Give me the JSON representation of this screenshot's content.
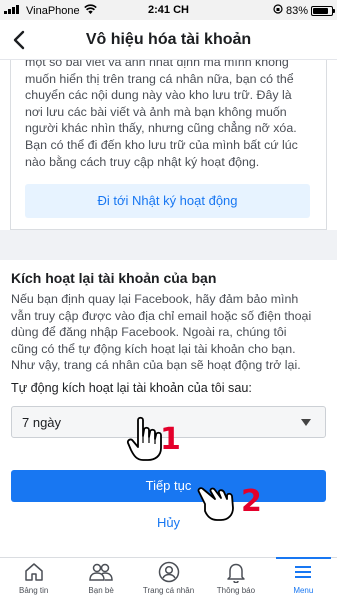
{
  "status_bar": {
    "carrier": "VinaPhone",
    "time": "2:41 CH",
    "battery": "83%",
    "battery_level": 0.83
  },
  "header": {
    "title": "Vô hiệu hóa tài khoản"
  },
  "archive_card": {
    "lines": [
      "một số bài viết và ảnh nhất định mà mình không",
      "muốn hiển thị trên trang cá nhân nữa, bạn có thể",
      "chuyển các nội dung này vào kho lưu trữ. Đây là",
      "nơi lưu các bài viết và ảnh mà bạn không muốn",
      "người khác nhìn thấy, nhưng cũng chẳng nỡ xóa.",
      "Bạn có thể đi đến kho lưu trữ của mình bất cứ lúc",
      "nào bằng cách truy cập nhật ký hoạt động."
    ],
    "button": "Đi tới Nhật ký hoạt động"
  },
  "reactivate": {
    "heading": "Kích hoạt lại tài khoản của bạn",
    "lines": [
      "Nếu bạn định quay lại Facebook, hãy đảm bảo mình",
      "vẫn truy cập được vào địa chỉ email hoặc số điện thoại",
      "dùng để đăng nhập Facebook. Ngoài ra, chúng tôi",
      "cũng có thể tự động kích hoạt lại tài khoản cho bạn.",
      "Như vậy, trang cá nhân của bạn sẽ hoạt động trở lại."
    ],
    "auto_label": "Tự động kích hoạt lại tài khoản của tôi sau:",
    "select_value": "7 ngày",
    "continue": "Tiếp tục",
    "cancel": "Hủy"
  },
  "annotations": {
    "step1": "1",
    "step2": "2"
  },
  "tabs": [
    {
      "label": "Bảng tin",
      "icon": "home-icon"
    },
    {
      "label": "Bạn bè",
      "icon": "friends-icon"
    },
    {
      "label": "Trang cá nhân",
      "icon": "profile-icon"
    },
    {
      "label": "Thông báo",
      "icon": "bell-icon"
    },
    {
      "label": "Menu",
      "icon": "menu-icon"
    }
  ],
  "colors": {
    "accent": "#1877f2",
    "annotation": "#e4002b"
  }
}
